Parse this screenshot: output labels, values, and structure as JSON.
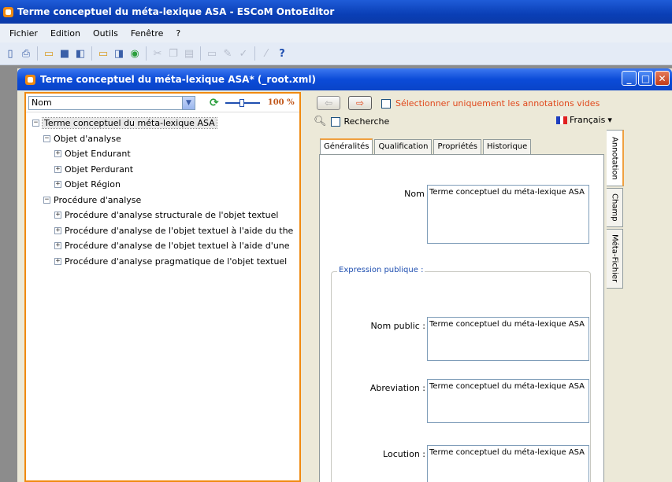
{
  "app": {
    "title": "Terme conceptuel du méta-lexique ASA - ESCoM OntoEditor"
  },
  "menu": [
    "Fichier",
    "Edition",
    "Outils",
    "Fenêtre",
    "?"
  ],
  "toolbar": [
    "new-icon",
    "print-icon",
    "open-icon",
    "save-icon",
    "save-all-icon",
    "open-dropdown-icon",
    "export-icon",
    "search-icon",
    "cut-icon",
    "copy-icon",
    "paste-icon",
    "rename-icon",
    "edit-icon",
    "check-icon",
    "wand-icon",
    "help-icon"
  ],
  "window": {
    "title": "Terme conceptuel du méta-lexique ASA* (_root.xml)"
  },
  "left": {
    "combo_value": "Nom",
    "zoom": "100 %",
    "tree": [
      {
        "label": "Terme conceptuel du méta-lexique ASA",
        "level": 0,
        "expander": "−",
        "selected": true
      },
      {
        "label": "Objet d'analyse",
        "level": 1,
        "expander": "−"
      },
      {
        "label": "Objet Endurant",
        "level": 2,
        "expander": "+"
      },
      {
        "label": "Objet Perdurant",
        "level": 2,
        "expander": "+"
      },
      {
        "label": "Objet Région",
        "level": 2,
        "expander": "+"
      },
      {
        "label": "Procédure d'analyse",
        "level": 1,
        "expander": "−"
      },
      {
        "label": "Procédure d'analyse structurale de l'objet textuel",
        "level": 2,
        "expander": "+"
      },
      {
        "label": "Procédure d'analyse de l'objet textuel à l'aide du the",
        "level": 2,
        "expander": "+"
      },
      {
        "label": "Procédure d'analyse de l'objet textuel à l'aide d'une",
        "level": 2,
        "expander": "+"
      },
      {
        "label": "Procédure d'analyse pragmatique de l'objet textuel",
        "level": 2,
        "expander": "+"
      }
    ]
  },
  "right": {
    "empty_only_label": "Sélectionner uniquement les annotations vides",
    "search_label": "Recherche",
    "language": "Français",
    "tabs": [
      "Généralités",
      "Qualification",
      "Propriétés",
      "Historique"
    ],
    "side_tabs": [
      "Annotation",
      "Champ",
      "Méta-Fichier"
    ],
    "nom_label": "Nom :",
    "nom_value": "Terme conceptuel du méta-lexique ASA",
    "group_title": "Expression publique :",
    "nom_public_label": "Nom public :",
    "nom_public_value": "Terme conceptuel du méta-lexique ASA",
    "abreviation_label": "Abreviation :",
    "abreviation_value": "Terme conceptuel du méta-lexique ASA",
    "locution_label": "Locution :",
    "locution_value": "Terme conceptuel du méta-lexique ASA"
  },
  "colors": {
    "accent": "#f08a10",
    "title_blue": "#0a44c8",
    "link_red": "#e0491d"
  }
}
